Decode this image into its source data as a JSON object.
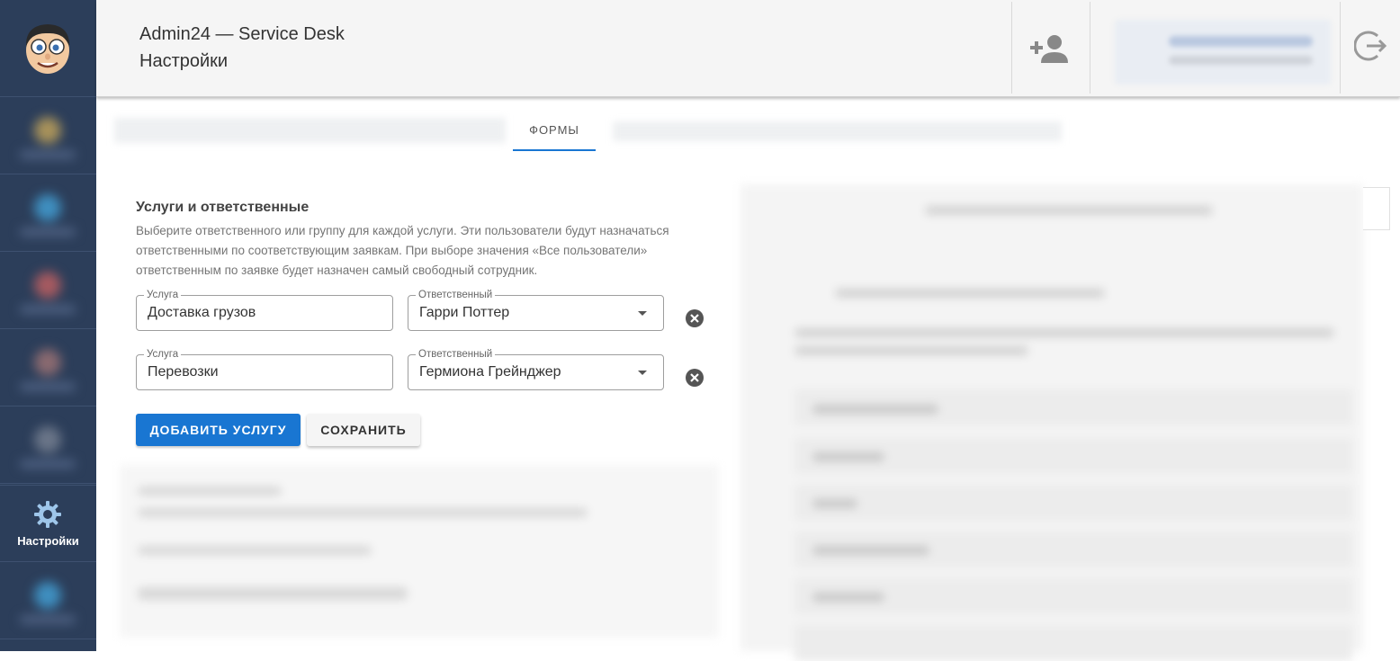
{
  "header": {
    "app_title": "Admin24 — Service Desk",
    "page_title": "Настройки"
  },
  "sidebar": {
    "active_label": "Настройки"
  },
  "tabs": {
    "active": "ФОРМЫ"
  },
  "section": {
    "title": "Услуги и ответственные",
    "description": "Выберите ответственного или группу для каждой услуги. Эти пользователи будут назначаться ответственными по соответствующим заявкам. При выборе значения «Все пользователи» ответственным по заявке будет назначен самый свободный сотрудник."
  },
  "rows": [
    {
      "service_label": "Услуга",
      "service_value": "Доставка грузов",
      "owner_label": "Ответственный",
      "owner_value": "Гарри Поттер"
    },
    {
      "service_label": "Услуга",
      "service_value": "Перевозки",
      "owner_label": "Ответственный",
      "owner_value": "Гермиона Грейнджер"
    }
  ],
  "buttons": {
    "add_service": "ДОБАВИТЬ УСЛУГУ",
    "save": "СОХРАНИТЬ"
  },
  "colors": {
    "sidebar_bg": "#2c3e5a",
    "accent": "#1976d2",
    "header_bg": "#f5f5f5"
  },
  "icons": {
    "logo": "cartoon-face-logo",
    "settings": "gear-icon",
    "add_user": "add-user-icon",
    "logout": "logout-icon",
    "remove": "close-circle-icon",
    "dropdown": "caret-down-icon"
  }
}
